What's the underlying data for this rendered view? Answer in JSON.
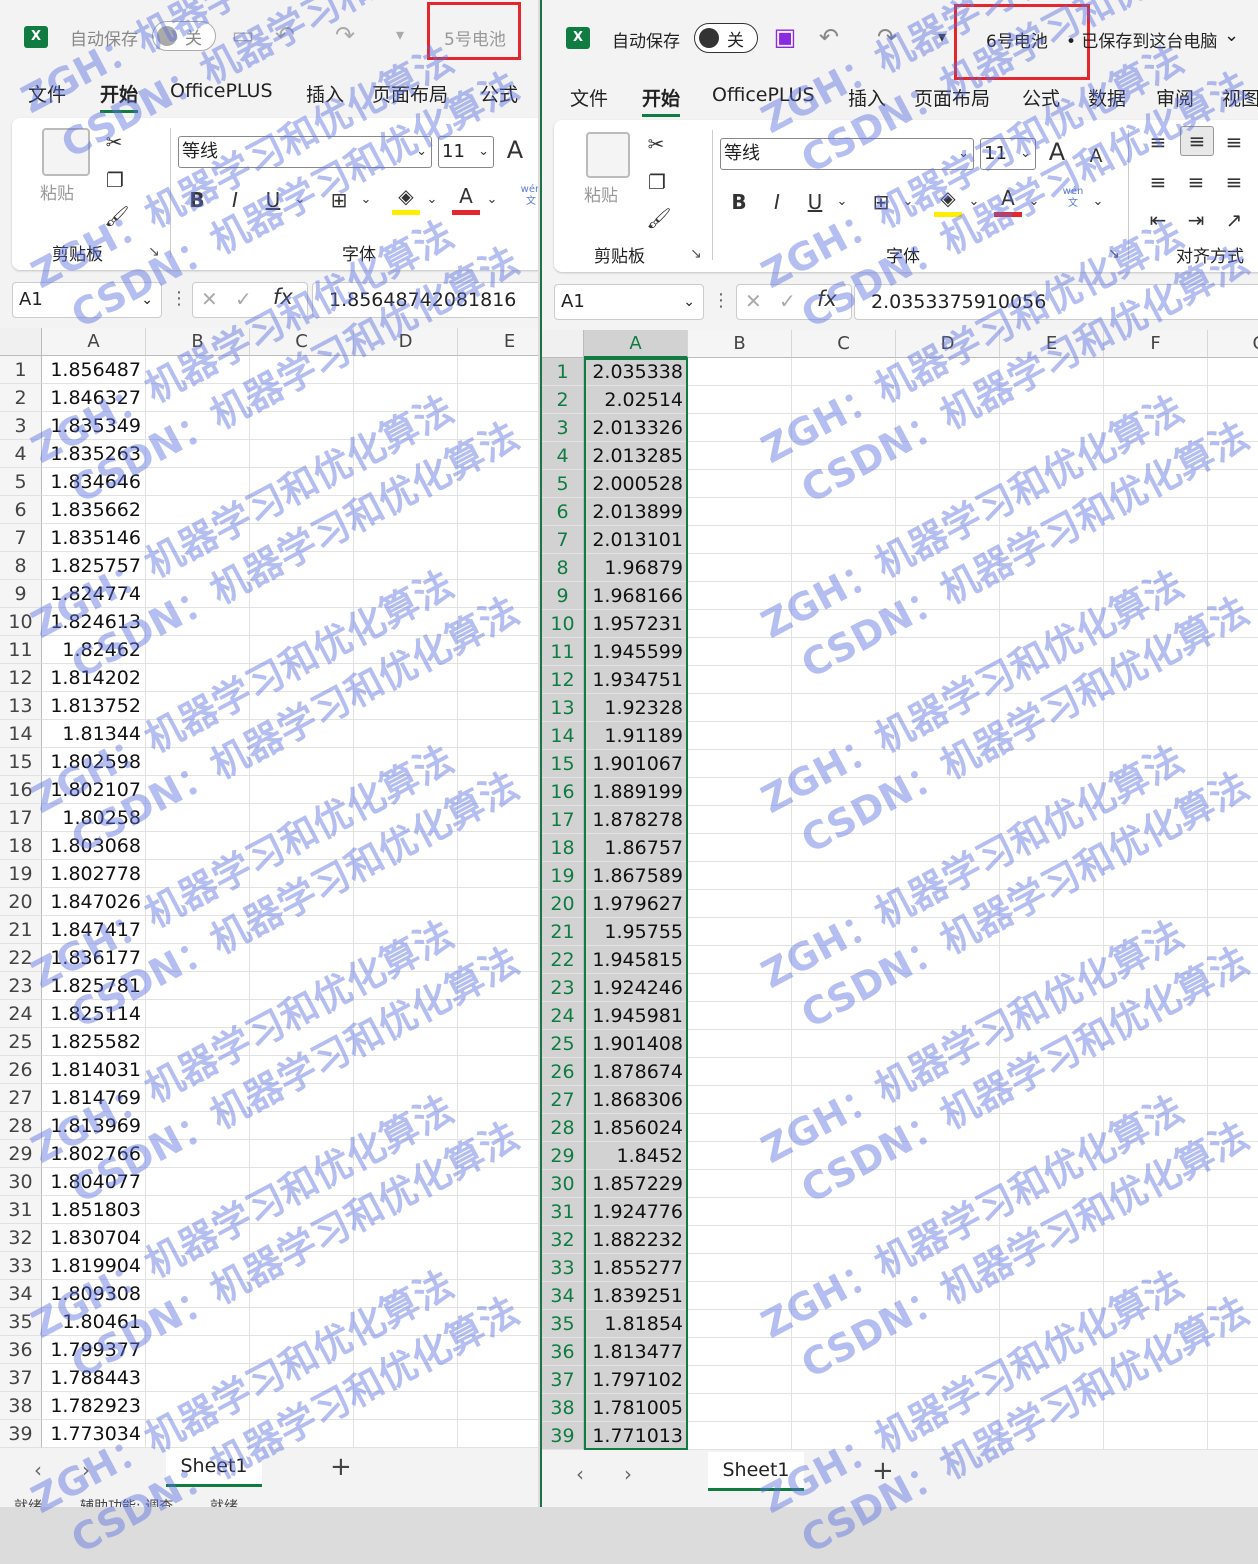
{
  "left_window": {
    "app_icon": "X",
    "autosave_label": "自动保存",
    "toggle_state": "关",
    "doc_title": "5号电池",
    "tabs": [
      "文件",
      "开始",
      "OfficePLUS",
      "插入",
      "页面布局",
      "公式"
    ],
    "clipboard": {
      "paste_label": "粘贴",
      "group_label": "剪贴板"
    },
    "font": {
      "name": "等线",
      "size": "11",
      "group_label": "字体",
      "bold": "B",
      "italic": "I",
      "underline": "U",
      "grow": "A",
      "color_a": "A",
      "phonetic": "wén\n文"
    },
    "name_box": "A1",
    "formula_value": "1.85648742081816",
    "columns": [
      "A",
      "B",
      "C",
      "D",
      "E"
    ],
    "rows": [
      "1",
      "2",
      "3",
      "4",
      "5",
      "6",
      "7",
      "8",
      "9",
      "10",
      "11",
      "12",
      "13",
      "14",
      "15",
      "16",
      "17",
      "18",
      "19",
      "20",
      "21",
      "22",
      "23",
      "24",
      "25",
      "26",
      "27",
      "28",
      "29",
      "30",
      "31",
      "32",
      "33",
      "34",
      "35",
      "36",
      "37",
      "38",
      "39"
    ],
    "values": [
      "1.856487",
      "1.846327",
      "1.835349",
      "1.835263",
      "1.834646",
      "1.835662",
      "1.835146",
      "1.825757",
      "1.824774",
      "1.824613",
      "1.82462",
      "1.814202",
      "1.813752",
      "1.81344",
      "1.802598",
      "1.802107",
      "1.80258",
      "1.803068",
      "1.802778",
      "1.847026",
      "1.847417",
      "1.836177",
      "1.825781",
      "1.825114",
      "1.825582",
      "1.814031",
      "1.814769",
      "1.813969",
      "1.802766",
      "1.804077",
      "1.851803",
      "1.830704",
      "1.819904",
      "1.809308",
      "1.80461",
      "1.799377",
      "1.788443",
      "1.782923",
      "1.773034"
    ],
    "sheet_tab": "Sheet1",
    "add_sheet": "+",
    "status_items": [
      "就绪",
      "辅助功能: 调查",
      "就绪"
    ]
  },
  "right_window": {
    "app_icon": "X",
    "autosave_label": "自动保存",
    "toggle_state": "关",
    "doc_title": "6号电池",
    "save_status": "• 已保存到这台电脑",
    "tabs": [
      "文件",
      "开始",
      "OfficePLUS",
      "插入",
      "页面布局",
      "公式",
      "数据",
      "审阅",
      "视图"
    ],
    "clipboard": {
      "paste_label": "粘贴",
      "group_label": "剪贴板"
    },
    "font": {
      "name": "等线",
      "size": "11",
      "group_label": "字体",
      "bold": "B",
      "italic": "I",
      "underline": "U",
      "grow": "A",
      "shrink": "A",
      "color_a": "A",
      "phonetic": "wén\n文"
    },
    "alignment": {
      "group_label": "对齐方式"
    },
    "name_box": "A1",
    "formula_value": "2.0353375910056",
    "columns": [
      "A",
      "B",
      "C",
      "D",
      "E",
      "F",
      "G"
    ],
    "rows": [
      "1",
      "2",
      "3",
      "4",
      "5",
      "6",
      "7",
      "8",
      "9",
      "10",
      "11",
      "12",
      "13",
      "14",
      "15",
      "16",
      "17",
      "18",
      "19",
      "20",
      "21",
      "22",
      "23",
      "24",
      "25",
      "26",
      "27",
      "28",
      "29",
      "30",
      "31",
      "32",
      "33",
      "34",
      "35",
      "36",
      "37",
      "38",
      "39"
    ],
    "values": [
      "2.035338",
      "2.02514",
      "2.013326",
      "2.013285",
      "2.000528",
      "2.013899",
      "2.013101",
      "1.96879",
      "1.968166",
      "1.957231",
      "1.945599",
      "1.934751",
      "1.92328",
      "1.91189",
      "1.901067",
      "1.889199",
      "1.878278",
      "1.86757",
      "1.867589",
      "1.979627",
      "1.95755",
      "1.945815",
      "1.924246",
      "1.945981",
      "1.901408",
      "1.878674",
      "1.868306",
      "1.856024",
      "1.8452",
      "1.857229",
      "1.924776",
      "1.882232",
      "1.855277",
      "1.839251",
      "1.81854",
      "1.813477",
      "1.797102",
      "1.781005",
      "1.771013"
    ],
    "sheet_tab": "Sheet1",
    "add_sheet": "+"
  },
  "watermark": {
    "line1": "ZGH：机器学习和优化算法",
    "line2": "CSDN：机器学习和优化算法"
  },
  "colors": {
    "excel_green": "#107c41",
    "highlight_red": "#e4262e",
    "watermark": "#5a6ee1"
  }
}
